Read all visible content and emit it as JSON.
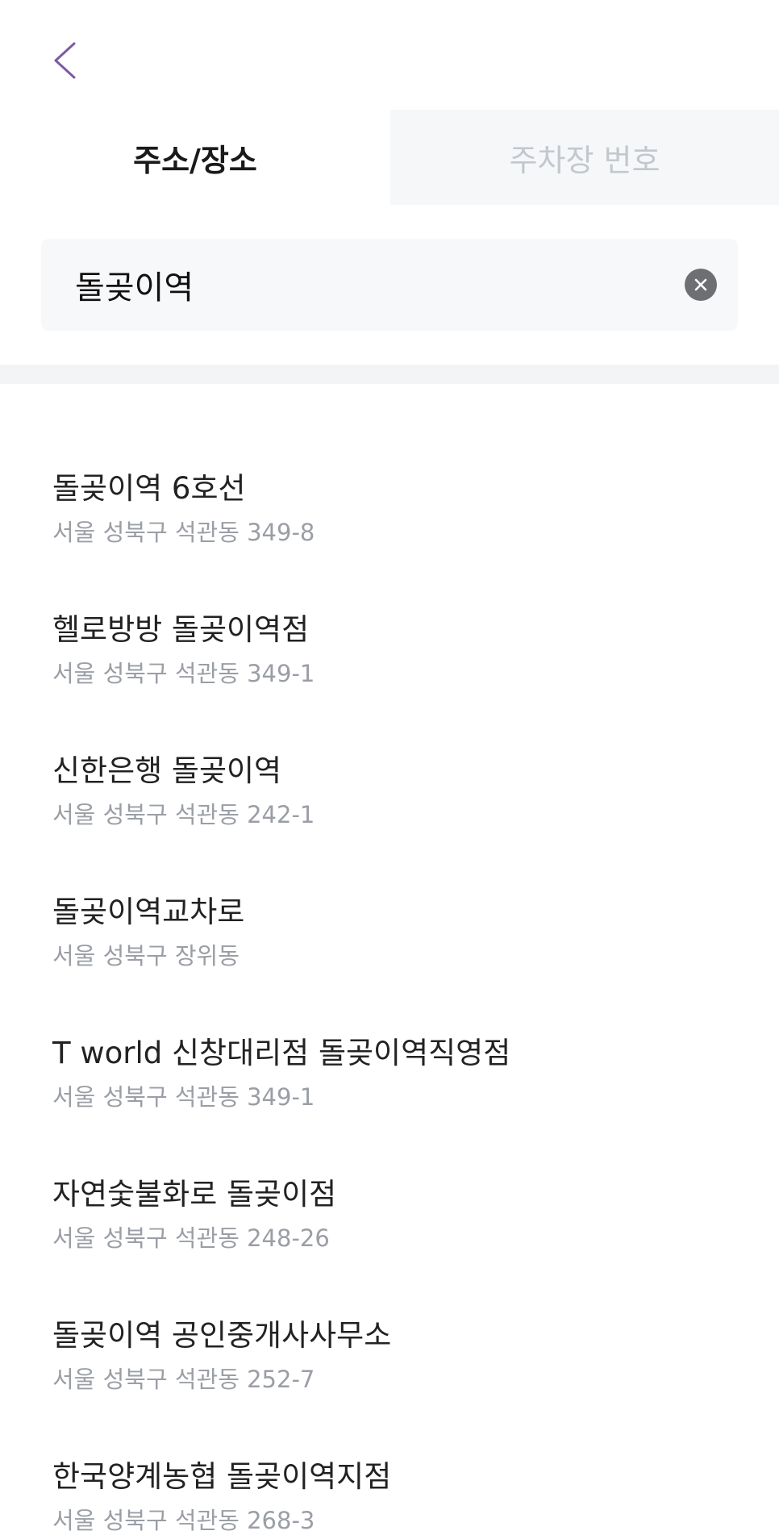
{
  "header": {
    "back_icon": "chevron-left-icon",
    "back_icon_color": "#7b5aa6"
  },
  "tabs": [
    {
      "label": "주소/장소",
      "active": true
    },
    {
      "label": "주차장 번호",
      "active": false
    }
  ],
  "search": {
    "value": "돌곶이역",
    "clear_icon": "close-circle-icon"
  },
  "results": [
    {
      "title": "돌곶이역 6호선",
      "address": "서울 성북구 석관동 349-8"
    },
    {
      "title": "헬로방방 돌곶이역점",
      "address": "서울 성북구 석관동 349-1"
    },
    {
      "title": "신한은행 돌곶이역",
      "address": "서울 성북구 석관동 242-1"
    },
    {
      "title": "돌곶이역교차로",
      "address": "서울 성북구 장위동"
    },
    {
      "title": "T world 신창대리점 돌곶이역직영점",
      "address": "서울 성북구 석관동 349-1"
    },
    {
      "title": "자연숯불화로 돌곶이점",
      "address": "서울 성북구 석관동 248-26"
    },
    {
      "title": "돌곶이역 공인중개사사무소",
      "address": "서울 성북구 석관동 252-7"
    },
    {
      "title": "한국양계농협 돌곶이역지점",
      "address": "서울 성북구 석관동 268-3"
    }
  ]
}
